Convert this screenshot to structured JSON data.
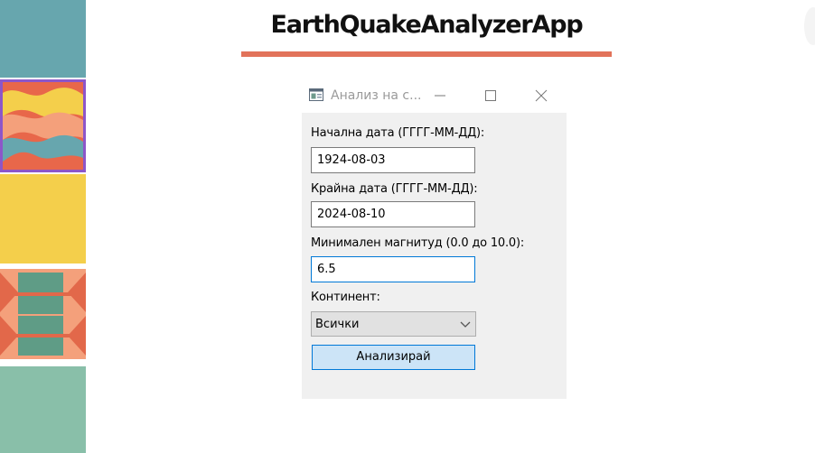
{
  "page": {
    "title": "EarthQuakeAnalyzerApp"
  },
  "window": {
    "title": "Анализ на с...",
    "icons": {
      "app": "window-app-icon",
      "minimize": "minimize-icon",
      "maximize": "maximize-icon",
      "close": "close-icon"
    }
  },
  "form": {
    "start_date": {
      "label": "Начална дата (ГГГГ-ММ-ДД):",
      "value": "1924-08-03"
    },
    "end_date": {
      "label": "Крайна дата (ГГГГ-ММ-ДД):",
      "value": "2024-08-10"
    },
    "min_magnitude": {
      "label": "Минимален магнитуд (0.0 до 10.0):",
      "value": "6.5"
    },
    "continent": {
      "label": "Континент:",
      "selected": "Всички"
    },
    "analyze_button": "Анализирай"
  },
  "colors": {
    "accent": "#e2735a",
    "focus_border": "#0078d7",
    "button_bg": "#cce4f7",
    "form_bg": "#f0f0f0"
  }
}
